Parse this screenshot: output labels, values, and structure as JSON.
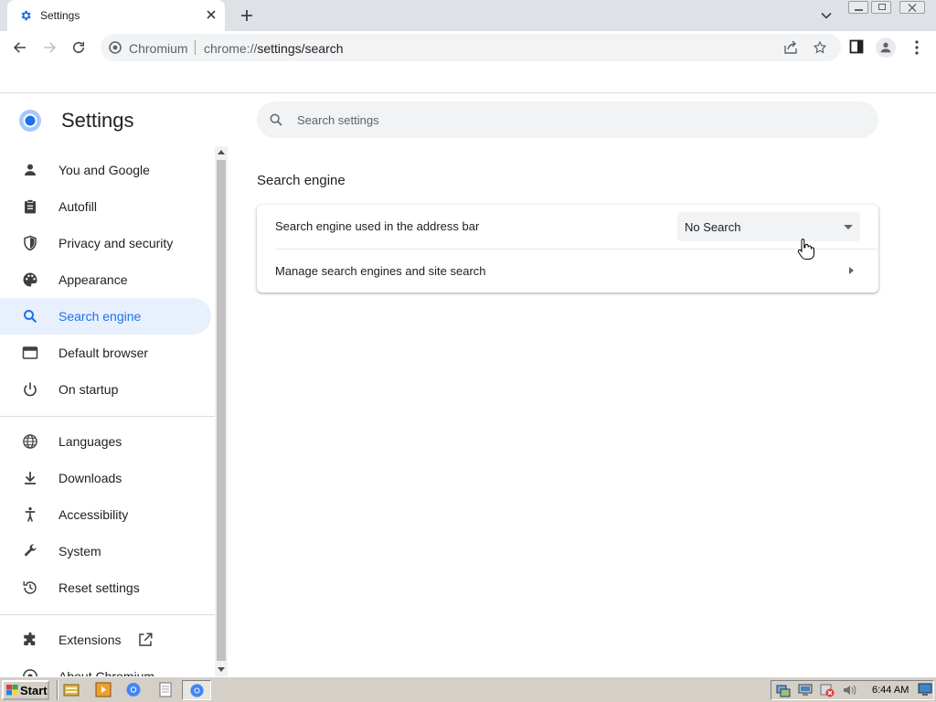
{
  "browser": {
    "tab_title": "Settings",
    "site_name": "Chromium",
    "url_scheme": "chrome://",
    "url_path": "settings/search"
  },
  "settings": {
    "title": "Settings",
    "search_placeholder": "Search settings"
  },
  "sidebar": {
    "items": [
      {
        "label": "You and Google",
        "icon": "person-icon"
      },
      {
        "label": "Autofill",
        "icon": "clipboard-icon"
      },
      {
        "label": "Privacy and security",
        "icon": "shield-icon"
      },
      {
        "label": "Appearance",
        "icon": "palette-icon"
      },
      {
        "label": "Search engine",
        "icon": "search-icon",
        "active": true
      },
      {
        "label": "Default browser",
        "icon": "browser-window-icon"
      },
      {
        "label": "On startup",
        "icon": "power-icon"
      },
      {
        "label": "Languages",
        "icon": "globe-icon"
      },
      {
        "label": "Downloads",
        "icon": "download-icon"
      },
      {
        "label": "Accessibility",
        "icon": "accessibility-icon"
      },
      {
        "label": "System",
        "icon": "wrench-icon"
      },
      {
        "label": "Reset settings",
        "icon": "history-icon"
      },
      {
        "label": "Extensions",
        "icon": "puzzle-icon"
      },
      {
        "label": "About Chromium",
        "icon": "chromium-icon"
      }
    ]
  },
  "main": {
    "section_title": "Search engine",
    "engine_row_label": "Search engine used in the address bar",
    "engine_value": "No Search",
    "manage_row_label": "Manage search engines and site search"
  },
  "taskbar": {
    "start_label": "Start",
    "clock": "6:44 AM"
  },
  "colors": {
    "accent": "#1a73e8",
    "active_bg": "#e8f0fe"
  }
}
